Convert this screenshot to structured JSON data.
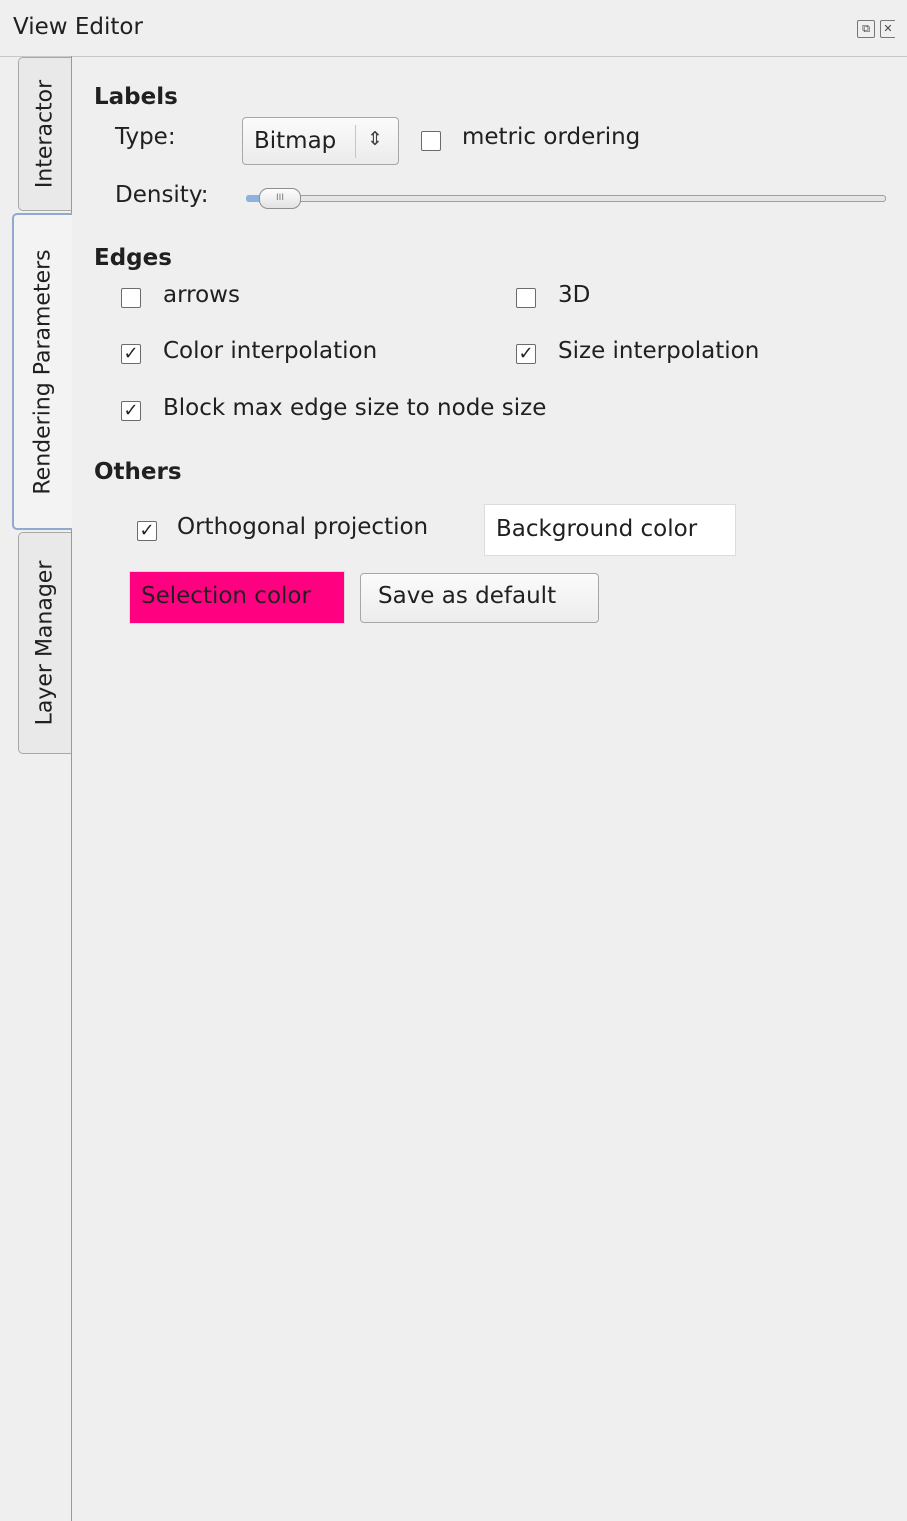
{
  "window": {
    "title": "View Editor"
  },
  "tabs": {
    "interactor": "Interactor",
    "rendering": "Rendering Parameters",
    "layers": "Layer Manager"
  },
  "labels": {
    "heading": "Labels",
    "type_label": "Type:",
    "type_value": "Bitmap",
    "metric_ordering": "metric ordering",
    "metric_ordering_checked": false,
    "density_label": "Density:",
    "density_level": 0.04
  },
  "edges": {
    "heading": "Edges",
    "arrows": "arrows",
    "arrows_checked": false,
    "three_d": "3D",
    "three_d_checked": false,
    "color_interp": "Color interpolation",
    "color_interp_checked": true,
    "size_interp": "Size interpolation",
    "size_interp_checked": true,
    "block_max": "Block max edge size to node size",
    "block_max_checked": true
  },
  "others": {
    "heading": "Others",
    "ortho": "Orthogonal projection",
    "ortho_checked": true,
    "background_color": "Background color",
    "selection_color": "Selection color",
    "save_default": "Save as default"
  },
  "colors": {
    "selection": "#ff0080",
    "background": "#ffffff",
    "accent": "#8fa9cf"
  },
  "icons": {
    "float": "float-icon",
    "close": "close-icon",
    "combo_arrow": "updown-chevron-icon",
    "check": "checkmark-icon"
  }
}
